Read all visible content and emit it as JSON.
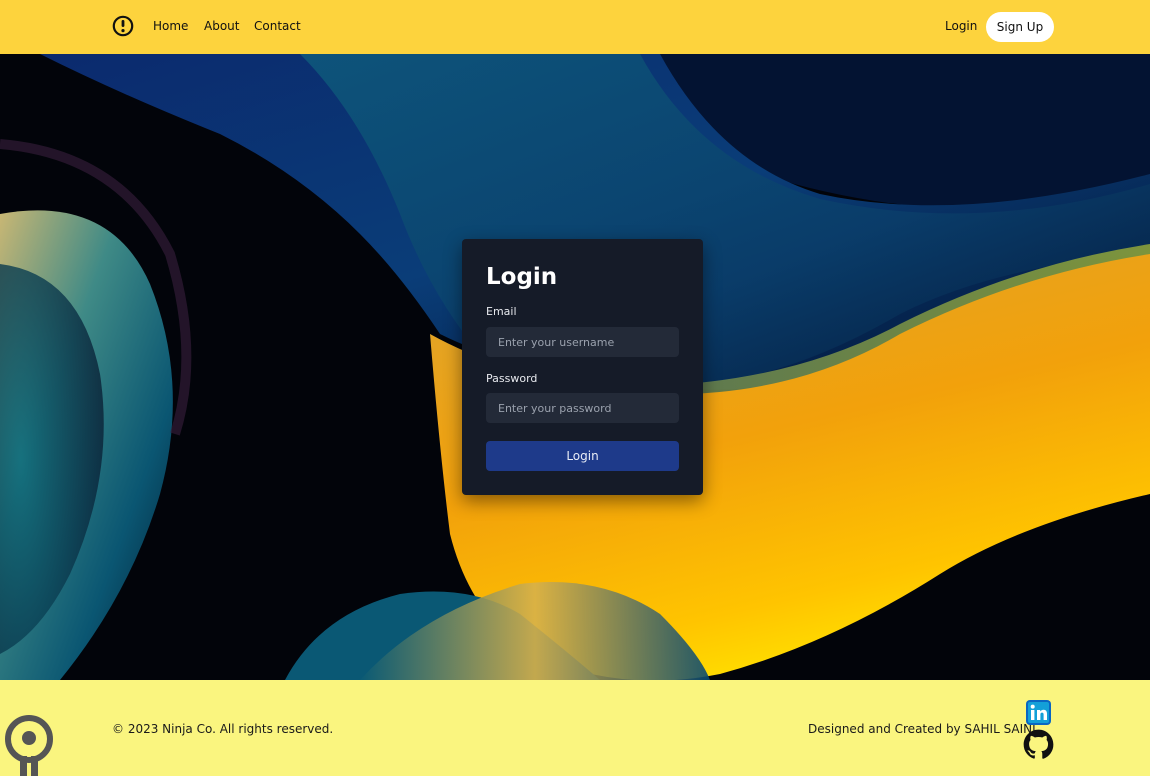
{
  "header": {
    "logo_icon": "alert-circle-icon",
    "nav": [
      {
        "label": "Home"
      },
      {
        "label": "About"
      },
      {
        "label": "Contact"
      }
    ],
    "login_label": "Login",
    "signup_label": "Sign Up"
  },
  "login_form": {
    "title": "Login",
    "email_label": "Email",
    "email_placeholder": "Enter your username",
    "password_label": "Password",
    "password_placeholder": "Enter your password",
    "submit_label": "Login"
  },
  "footer": {
    "copyright": "© 2023 Ninja Co. All rights reserved.",
    "credit": "Designed and Created by SAHIL SAINI",
    "social_icons": [
      "linkedin-icon",
      "github-icon"
    ]
  },
  "colors": {
    "header_bg": "#fdd33d",
    "footer_bg": "#faf57f",
    "card_bg": "#151b28",
    "input_bg": "#232a38",
    "button_bg": "#1e3a8a",
    "linkedin": "#0a66c2"
  }
}
